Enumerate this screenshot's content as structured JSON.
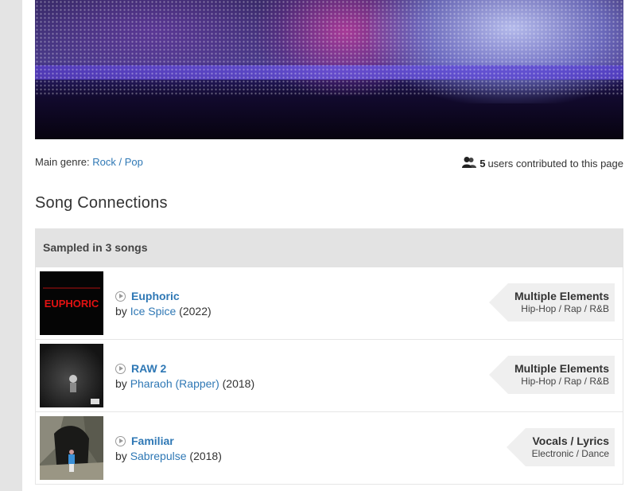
{
  "meta": {
    "genre_label": "Main genre:",
    "genre_value": "Rock / Pop",
    "contributors_count": "5",
    "contributors_text": "users contributed to this page"
  },
  "connections": {
    "heading": "Song Connections",
    "section_title": "Sampled in 3 songs",
    "items": [
      {
        "title": "Euphoric",
        "by": "by",
        "artist": "Ice Spice",
        "year": "(2022)",
        "kind": "Multiple Elements",
        "genre": "Hip-Hop / Rap / R&B",
        "thumb_text": "EUPHORIC"
      },
      {
        "title": "RAW 2",
        "by": "by",
        "artist": "Pharaoh (Rapper)",
        "year": "(2018)",
        "kind": "Multiple Elements",
        "genre": "Hip-Hop / Rap / R&B"
      },
      {
        "title": "Familiar",
        "by": "by",
        "artist": "Sabrepulse",
        "year": "(2018)",
        "kind": "Vocals / Lyrics",
        "genre": "Electronic / Dance"
      }
    ]
  },
  "colors": {
    "link": "#2f78b5",
    "header_bg": "#e3e3e3",
    "tag_bg": "#efefef"
  },
  "icons": {
    "contributors": "users-icon",
    "play": "play-icon"
  }
}
